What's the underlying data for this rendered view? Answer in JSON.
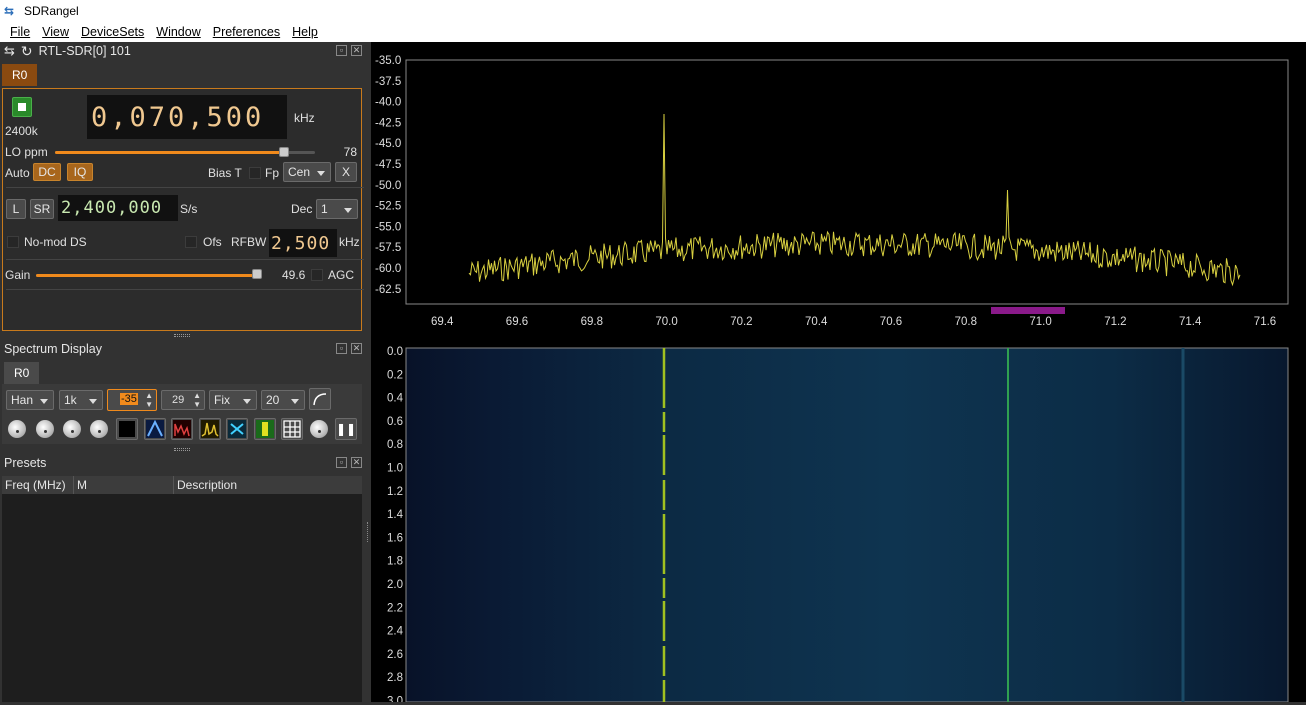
{
  "window": {
    "title": "SDRangel"
  },
  "menu": [
    "File",
    "View",
    "DeviceSets",
    "Window",
    "Preferences",
    "Help"
  ],
  "device": {
    "title": "RTL-SDR[0] 101",
    "tab": "R0",
    "samplerate_label": "2400k",
    "frequency": "0,070,500",
    "freq_unit": "kHz",
    "lo_label": "LO ppm",
    "lo_value": "78",
    "lo_fraction": 0.88,
    "auto_label": "Auto",
    "dc_label": "DC",
    "iq_label": "IQ",
    "biast_label": "Bias T",
    "fp_label": "Fp",
    "fp_value": "Cen",
    "x_label": "X",
    "l_label": "L",
    "sr_label": "SR",
    "sr_value": "2,400,000",
    "sr_unit": "S/s",
    "dec_label": "Dec",
    "dec_value": "1",
    "nomod_label": "No-mod DS",
    "ofs_label": "Ofs",
    "rfbw_label": "RFBW",
    "rfbw_value": "2,500",
    "rfbw_unit": "kHz",
    "gain_label": "Gain",
    "gain_value": "49.6",
    "gain_fraction": 0.98,
    "agc_label": "AGC"
  },
  "spectrum_display": {
    "title": "Spectrum Display",
    "tab": "R0",
    "window": "Han",
    "fft": "1k",
    "ref": "-35",
    "range": "29",
    "mode": "Fix",
    "avg": "20"
  },
  "presets": {
    "title": "Presets",
    "columns": [
      "Freq (MHz)",
      "M",
      "Description"
    ]
  },
  "spectrum": {
    "y_ticks": [
      "-35.0",
      "-37.5",
      "-40.0",
      "-42.5",
      "-45.0",
      "-47.5",
      "-50.0",
      "-52.5",
      "-55.0",
      "-57.5",
      "-60.0",
      "-62.5"
    ],
    "x_ticks": [
      "69.4",
      "69.6",
      "69.8",
      "70.0",
      "70.2",
      "70.4",
      "70.6",
      "70.8",
      "71.0",
      "71.2",
      "71.4",
      "71.6"
    ],
    "wf_ticks": [
      "0.0",
      "0.2",
      "0.4",
      "0.6",
      "0.8",
      "1.0",
      "1.2",
      "1.4",
      "1.6",
      "1.8",
      "2.0",
      "2.2",
      "2.4",
      "2.6",
      "2.8",
      "3.0"
    ],
    "trace_color": "#d8d040",
    "channel_color": "#8a1a8a"
  }
}
